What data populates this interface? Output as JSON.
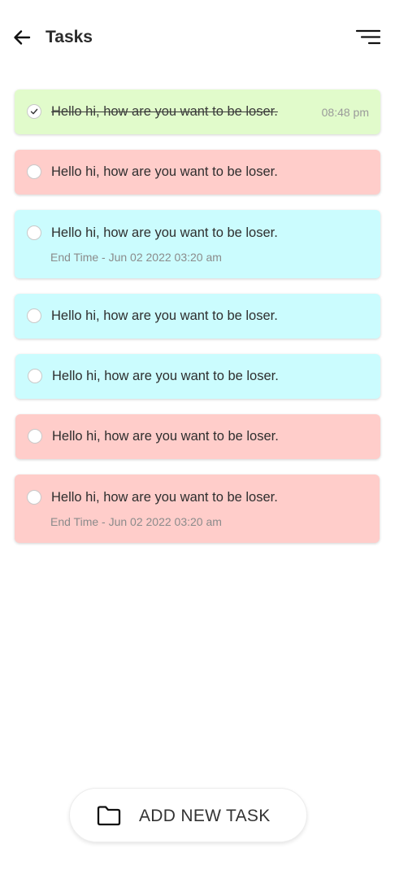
{
  "header": {
    "title": "Tasks",
    "back_icon": "arrow-left-icon",
    "menu_icon": "sort-menu-icon"
  },
  "colors": {
    "done": "#e1fbcb",
    "red": "#ffcdca",
    "cyan": "#cbfcfe"
  },
  "tasks": [
    {
      "text": "Hello hi, how are you want to be loser.",
      "time": "08:48 pm",
      "completed": true,
      "color": "done"
    },
    {
      "text": "Hello hi, how are you want to be loser.",
      "completed": false,
      "color": "red"
    },
    {
      "text": "Hello hi, how are you want to be loser.",
      "end_time": "End Time - Jun 02 2022 03:20 am",
      "completed": false,
      "color": "cyan"
    },
    {
      "text": "Hello hi, how are you want to be loser.",
      "completed": false,
      "color": "cyan"
    },
    {
      "text": "Hello hi, how are you want to be loser.",
      "completed": false,
      "color": "cyan"
    },
    {
      "text": "Hello hi, how are you want to be loser.",
      "completed": false,
      "color": "red"
    },
    {
      "text": "Hello hi, how are you want to be loser.",
      "end_time": "End Time - Jun 02 2022 03:20 am",
      "completed": false,
      "color": "red"
    }
  ],
  "add_button": {
    "label": "ADD NEW TASK",
    "icon": "folder-icon"
  }
}
